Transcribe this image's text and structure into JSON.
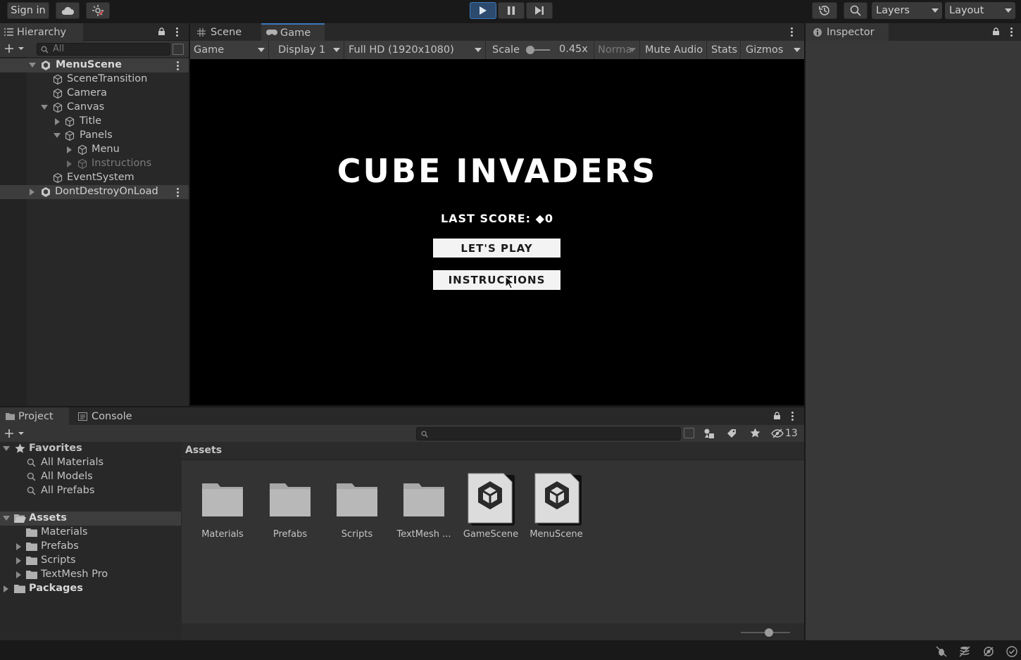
{
  "toolbar": {
    "sign_in": "Sign in",
    "layers": "Layers",
    "layout": "Layout"
  },
  "hierarchy": {
    "tab": "Hierarchy",
    "search_placeholder": "All",
    "items": [
      {
        "label": "MenuScene",
        "kind": "scene",
        "depth": 0,
        "expanded": true,
        "selected": true
      },
      {
        "label": "SceneTransition",
        "kind": "object",
        "depth": 1
      },
      {
        "label": "Camera",
        "kind": "object",
        "depth": 1
      },
      {
        "label": "Canvas",
        "kind": "object",
        "depth": 1,
        "expanded": true
      },
      {
        "label": "Title",
        "kind": "object",
        "depth": 2,
        "collapsed": true
      },
      {
        "label": "Panels",
        "kind": "object",
        "depth": 2,
        "expanded": true
      },
      {
        "label": "Menu",
        "kind": "object",
        "depth": 3,
        "collapsed": true
      },
      {
        "label": "Instructions",
        "kind": "object",
        "depth": 3,
        "collapsed": true,
        "disabled": true
      },
      {
        "label": "EventSystem",
        "kind": "object",
        "depth": 1
      },
      {
        "label": "DontDestroyOnLoad",
        "kind": "scene",
        "depth": 0,
        "collapsed": true,
        "selected": true
      }
    ]
  },
  "views": {
    "scene_tab": "Scene",
    "game_tab": "Game",
    "inspector_tab": "Inspector"
  },
  "game_bar": {
    "mode": "Game",
    "display": "Display 1",
    "resolution": "Full HD (1920x1080)",
    "scale_label": "Scale",
    "scale_value": "0.45x",
    "play_focus": "Norma",
    "mute": "Mute Audio",
    "stats": "Stats",
    "gizmos": "Gizmos"
  },
  "game": {
    "title": "CUBE INVADERS",
    "last_score": "LAST SCORE: ◆0",
    "play_button": "LET'S PLAY",
    "instructions_button": "INSTRUCTIONS"
  },
  "project": {
    "project_tab": "Project",
    "console_tab": "Console",
    "hidden_count": "13",
    "favorites": {
      "label": "Favorites",
      "items": [
        "All Materials",
        "All Models",
        "All Prefabs"
      ]
    },
    "assets_root": "Assets",
    "asset_tree": [
      "Materials",
      "Prefabs",
      "Scripts",
      "TextMesh Pro"
    ],
    "packages": "Packages",
    "breadcrumb": "Assets",
    "grid": [
      {
        "label": "Materials",
        "type": "folder"
      },
      {
        "label": "Prefabs",
        "type": "folder"
      },
      {
        "label": "Scripts",
        "type": "folder"
      },
      {
        "label": "TextMesh ...",
        "type": "folder"
      },
      {
        "label": "GameScene",
        "type": "scene"
      },
      {
        "label": "MenuScene",
        "type": "scene"
      }
    ]
  },
  "colors": {
    "accent": "#3a79bb",
    "play_active": "#2c4a6e",
    "selected_row": "#3d3d3d"
  }
}
